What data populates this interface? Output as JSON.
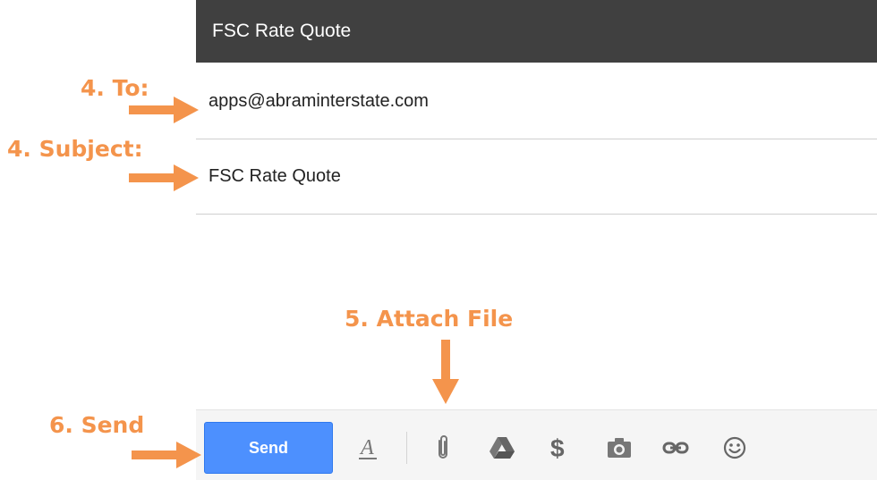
{
  "compose": {
    "title": "FSC Rate Quote",
    "to_value": "apps@abraminterstate.com",
    "subject_value": "FSC Rate Quote",
    "body_value": ""
  },
  "toolbar": {
    "send_label": "Send",
    "icons": [
      "format-text-icon",
      "attach-icon",
      "drive-icon",
      "money-icon",
      "photo-icon",
      "link-icon",
      "emoji-icon"
    ]
  },
  "annotations": {
    "to_label": "4. To:",
    "subject_label": "4. Subject:",
    "attach_label": "5. Attach File",
    "send_label": "6. Send"
  },
  "colors": {
    "title_bar": "#404040",
    "send_button": "#4d90fe",
    "annotation": "#f4944c"
  }
}
